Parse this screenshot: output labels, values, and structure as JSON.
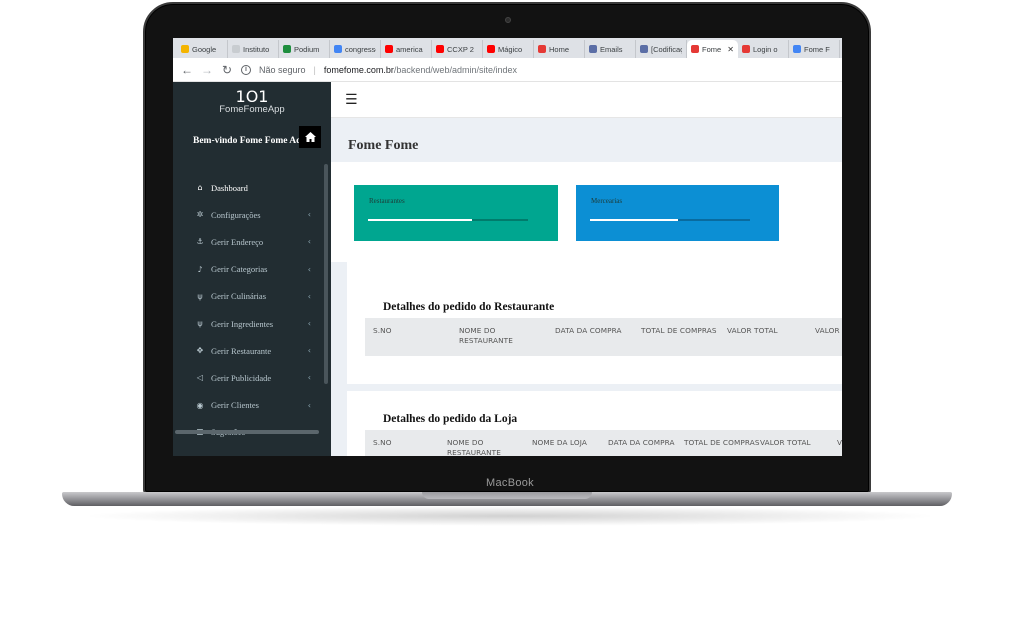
{
  "device": {
    "brand_label": "MacBook"
  },
  "browser": {
    "tabs": [
      {
        "title": "Google",
        "icon": "google-calendar-icon",
        "color": "#f4b400"
      },
      {
        "title": "Instituto",
        "icon": "globe-icon",
        "color": "#c8ccd0"
      },
      {
        "title": "Podium",
        "icon": "podium-icon",
        "color": "#1e8e3e"
      },
      {
        "title": "congresso",
        "icon": "google-g-icon",
        "color": "#4285f4"
      },
      {
        "title": "america",
        "icon": "youtube-icon",
        "color": "#ff0000"
      },
      {
        "title": "CCXP 2",
        "icon": "youtube-icon",
        "color": "#ff0000"
      },
      {
        "title": "Mágico",
        "icon": "youtube-icon",
        "color": "#ff0000"
      },
      {
        "title": "Home",
        "icon": "app-icon",
        "color": "#e53935"
      },
      {
        "title": "Emails",
        "icon": "grid-icon",
        "color": "#5b6ea6"
      },
      {
        "title": "[Codificação]",
        "icon": "grid-icon",
        "color": "#5b6ea6"
      },
      {
        "title": "Fome",
        "icon": "app-logo-icon",
        "color": "#e53935",
        "active": true
      },
      {
        "title": "Login o",
        "icon": "app-logo-icon",
        "color": "#e53935"
      },
      {
        "title": "Fome F",
        "icon": "docs-icon",
        "color": "#4285f4"
      }
    ],
    "security_label": "Não seguro",
    "url_host": "fomefome.com.br",
    "url_path": "/backend/web/admin/site/index"
  },
  "sidebar": {
    "logo_text": "FomeFomeApp",
    "welcome": "Bem-vindo Fome Fome Admin",
    "items": [
      {
        "label": "Dashboard",
        "icon": "home-icon",
        "glyph": "⌂",
        "active": true,
        "has_submenu": false
      },
      {
        "label": "Configurações",
        "icon": "gear-icon",
        "glyph": "✲",
        "has_submenu": true
      },
      {
        "label": "Gerir Endereço",
        "icon": "anchor-icon",
        "glyph": "⚓",
        "has_submenu": true
      },
      {
        "label": "Gerir Categorias",
        "icon": "bell-icon",
        "glyph": "♪",
        "has_submenu": true
      },
      {
        "label": "Gerir Culinárias",
        "icon": "utensils-icon",
        "glyph": "ψ",
        "has_submenu": true
      },
      {
        "label": "Gerir Ingredientes",
        "icon": "utensils-icon",
        "glyph": "ψ",
        "has_submenu": true
      },
      {
        "label": "Gerir Restaurante",
        "icon": "move-icon",
        "glyph": "✥",
        "has_submenu": true
      },
      {
        "label": "Gerir Publicidade",
        "icon": "bullhorn-icon",
        "glyph": "◁",
        "has_submenu": true
      },
      {
        "label": "Gerir Clientes",
        "icon": "circle-icon",
        "glyph": "◉",
        "has_submenu": true
      },
      {
        "label": "Sugestões",
        "icon": "list-icon",
        "glyph": "☰",
        "has_submenu": false
      }
    ]
  },
  "main": {
    "page_title": "Fome Fome",
    "stats": [
      {
        "label": "Restaurantes",
        "color": "#00a690",
        "progress": 0.65
      },
      {
        "label": "Mercearias",
        "color": "#0c8fd4",
        "progress": 0.55
      }
    ],
    "restaurant_orders": {
      "title": "Detalhes do pedido do Restaurante",
      "columns": [
        "S.NO",
        "NOME DO RESTAURANTE",
        "DATA DA COMPRA",
        "TOTAL DE COMPRAS",
        "VALOR TOTAL",
        "VALOR RESTA"
      ]
    },
    "store_orders": {
      "title": "Detalhes do pedido da Loja",
      "columns": [
        "S.NO",
        "NOME DO RESTAURANTE",
        "NOME DA LOJA",
        "DATA DA COMPRA",
        "TOTAL DE COMPRAS",
        "VALOR TOTAL",
        "V R"
      ]
    }
  }
}
